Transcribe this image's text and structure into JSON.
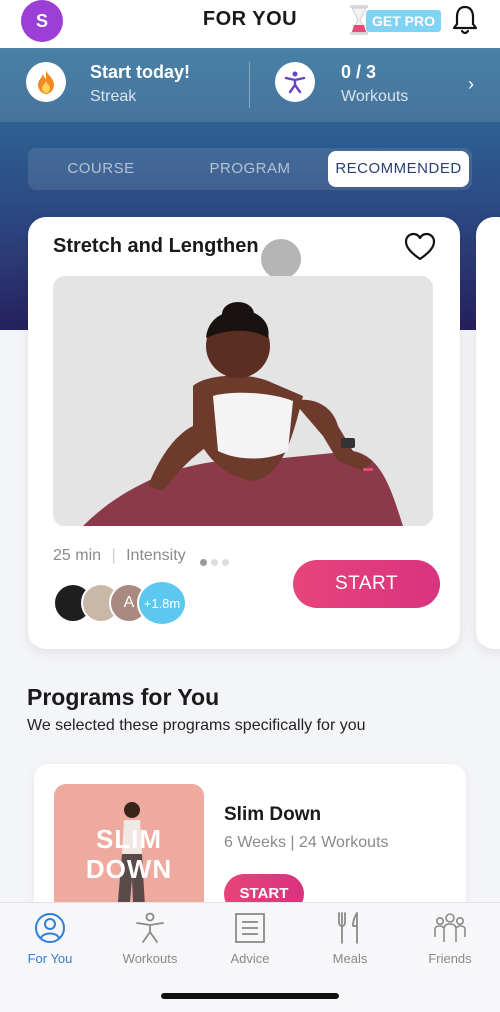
{
  "header": {
    "avatar_letter": "S",
    "title": "FOR YOU",
    "pro_label": "GET PRO",
    "icons": {
      "hourglass": "hourglass-icon",
      "bell": "bell-icon"
    }
  },
  "stats": {
    "streak": {
      "main": "Start today!",
      "sub": "Streak",
      "icon": "flame-icon"
    },
    "workouts": {
      "main": "0 / 3",
      "sub": "Workouts",
      "icon": "person-workout-icon"
    },
    "chevron": "›"
  },
  "segments": {
    "items": [
      "COURSE",
      "PROGRAM",
      "RECOMMENDED"
    ],
    "active": "RECOMMENDED"
  },
  "featured": {
    "title": "Stretch and Lengthen",
    "duration": "25 min",
    "separator": "|",
    "intensity_label": "Intensity",
    "intensity_level": 1,
    "intensity_max": 3,
    "avatar_letter": "A",
    "participants": "+1.8m",
    "start_label": "START"
  },
  "programs": {
    "title": "Programs for You",
    "subtitle": "We selected these programs specifically for you",
    "items": [
      {
        "thumb_text": "SLIM DOWN",
        "name": "Slim Down",
        "meta": "6 Weeks | 24 Workouts",
        "start_label": "START"
      }
    ]
  },
  "nav": {
    "items": [
      {
        "label": "For You",
        "icon": "for-you-icon",
        "active": true
      },
      {
        "label": "Workouts",
        "icon": "workouts-icon",
        "active": false
      },
      {
        "label": "Advice",
        "icon": "advice-icon",
        "active": false
      },
      {
        "label": "Meals",
        "icon": "meals-icon",
        "active": false
      },
      {
        "label": "Friends",
        "icon": "friends-icon",
        "active": false
      }
    ]
  },
  "colors": {
    "accent_pink": "#e0407c",
    "nav_active": "#2f7fd6",
    "hero_top": "#2f6f9a",
    "hero_bottom": "#26205e",
    "avatar_purple": "#9b3fd6"
  }
}
